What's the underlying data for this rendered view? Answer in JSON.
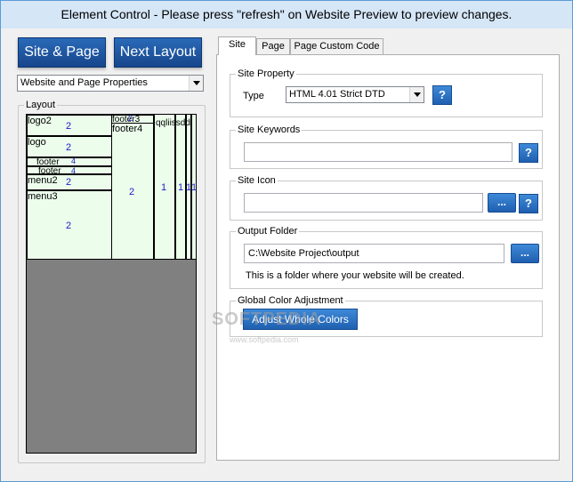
{
  "window": {
    "title": "Element Control - Please press \"refresh\" on Website Preview to preview changes."
  },
  "left": {
    "site_page_button": "Site & Page",
    "next_layout_button": "Next Layout",
    "properties_combo": "Website and Page Properties",
    "layout_label": "Layout",
    "cells": [
      {
        "label": "logo2",
        "num": "2"
      },
      {
        "label": "logo",
        "num": "2"
      },
      {
        "label": "footer",
        "num": "4"
      },
      {
        "label": "footer",
        "num": "4"
      },
      {
        "label": "menu2",
        "num": "2"
      },
      {
        "label": "menu3",
        "num": "2"
      },
      {
        "label": "footer3",
        "num": "2"
      },
      {
        "label": "footer4",
        "num": "2"
      },
      {
        "label": "qqliissdd",
        "nums": [
          "1",
          "1",
          "1",
          "1"
        ]
      }
    ]
  },
  "tabs": [
    {
      "label": "Site",
      "active": true
    },
    {
      "label": "Page"
    },
    {
      "label": "Page Custom Code"
    }
  ],
  "site": {
    "property": {
      "legend": "Site Property",
      "type_label": "Type",
      "type_value": "HTML 4.01 Strict DTD",
      "help": "?"
    },
    "keywords": {
      "legend": "Site Keywords",
      "value": "",
      "help": "?"
    },
    "icon": {
      "legend": "Site Icon",
      "value": "",
      "browse": "...",
      "help": "?"
    },
    "output": {
      "legend": "Output Folder",
      "value": "C:\\Website Project\\output",
      "browse": "...",
      "note": "This is a folder where your website will be created."
    },
    "color": {
      "legend": "Global Color Adjustment",
      "button": "Adjust Whole Colors"
    }
  },
  "watermark": {
    "main": "SOFTPEDIA",
    "sub": "www.softpedia.com"
  }
}
